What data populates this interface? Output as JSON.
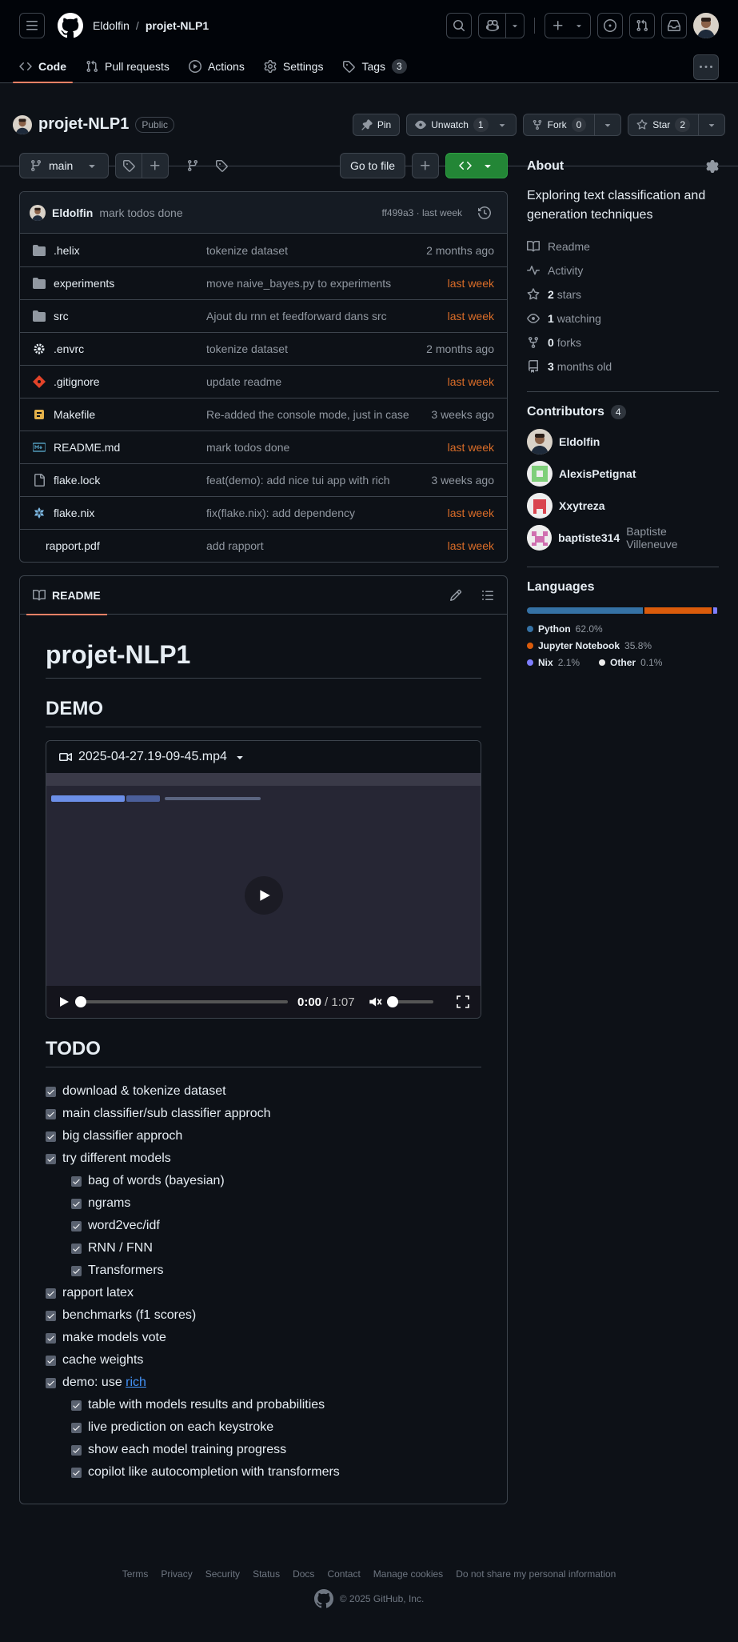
{
  "header": {
    "owner": "Eldolfin",
    "separator": "/",
    "repo": "projet-NLP1"
  },
  "nav": {
    "tabs": [
      {
        "label": "Code",
        "icon": "code-icon"
      },
      {
        "label": "Pull requests",
        "icon": "git-pull-request-icon"
      },
      {
        "label": "Actions",
        "icon": "play-icon"
      },
      {
        "label": "Settings",
        "icon": "gear-icon"
      },
      {
        "label": "Tags",
        "icon": "tag-icon",
        "count": "3"
      }
    ]
  },
  "repo": {
    "name": "projet-NLP1",
    "visibility": "Public",
    "pin_label": "Pin",
    "watch_label": "Unwatch",
    "watch_count": "1",
    "fork_label": "Fork",
    "fork_count": "0",
    "star_label": "Star",
    "star_count": "2"
  },
  "toolbar": {
    "branch": "main",
    "go_to_file": "Go to file"
  },
  "commit": {
    "author": "Eldolfin",
    "message": "mark todos done",
    "meta": "ff499a3 · last week"
  },
  "files": [
    {
      "name": ".helix",
      "type": "folder",
      "message": "tokenize dataset",
      "date": "2 months ago",
      "recent": false
    },
    {
      "name": "experiments",
      "type": "folder",
      "message": "move naive_bayes.py to experiments",
      "date": "last week",
      "recent": true
    },
    {
      "name": "src",
      "type": "folder",
      "message": "Ajout du rnn et feedforward dans src",
      "date": "last week",
      "recent": true
    },
    {
      "name": ".envrc",
      "type": "gear",
      "message": "tokenize dataset",
      "date": "2 months ago",
      "recent": false
    },
    {
      "name": ".gitignore",
      "type": "git",
      "message": "update readme",
      "date": "last week",
      "recent": true
    },
    {
      "name": "Makefile",
      "type": "make",
      "message": "Re-added the console mode, just in case",
      "date": "3 weeks ago",
      "recent": false
    },
    {
      "name": "README.md",
      "type": "markdown",
      "message": "mark todos done",
      "date": "last week",
      "recent": true
    },
    {
      "name": "flake.lock",
      "type": "file",
      "message": "feat(demo): add nice tui app with rich",
      "date": "3 weeks ago",
      "recent": false
    },
    {
      "name": "flake.nix",
      "type": "nix",
      "message": "fix(flake.nix): add dependency",
      "date": "last week",
      "recent": true
    },
    {
      "name": "rapport.pdf",
      "type": "none",
      "message": "add rapport",
      "date": "last week",
      "recent": true
    }
  ],
  "readme": {
    "tab_label": "README",
    "title": "projet-NLP1",
    "demo_heading": "DEMO",
    "video_file": "2025-04-27.19-09-45.mp4",
    "video_time": "0:00",
    "video_duration": "/ 1:07",
    "todo_heading": "TODO",
    "todos": [
      {
        "text": "download & tokenize dataset",
        "sub": false
      },
      {
        "text": "main classifier/sub classifier approch",
        "sub": false
      },
      {
        "text": "big classifier approch",
        "sub": false
      },
      {
        "text": "try different models",
        "sub": false
      },
      {
        "text": "bag of words (bayesian)",
        "sub": true
      },
      {
        "text": "ngrams",
        "sub": true
      },
      {
        "text": "word2vec/idf",
        "sub": true
      },
      {
        "text": "RNN / FNN",
        "sub": true
      },
      {
        "text": "Transformers",
        "sub": true
      },
      {
        "text": "rapport latex",
        "sub": false
      },
      {
        "text": "benchmarks (f1 scores)",
        "sub": false
      },
      {
        "text": "make models vote",
        "sub": false
      },
      {
        "text": "cache weights",
        "sub": false
      },
      {
        "text": "demo: use ",
        "link": "rich",
        "sub": false
      },
      {
        "text": "table with models results and probabilities",
        "sub": true
      },
      {
        "text": "live prediction on each keystroke",
        "sub": true
      },
      {
        "text": "show each model training progress",
        "sub": true
      },
      {
        "text": "copilot like autocompletion with transformers",
        "sub": true
      }
    ]
  },
  "about": {
    "heading": "About",
    "description": "Exploring text classification and generation techniques",
    "readme": "Readme",
    "activity": "Activity",
    "stars_count": "2",
    "stars_label": "stars",
    "watching_count": "1",
    "watching_label": "watching",
    "forks_count": "0",
    "forks_label": "forks",
    "age_count": "3",
    "age_label": "months old"
  },
  "contributors": {
    "heading": "Contributors",
    "count": "4",
    "list": [
      {
        "login": "Eldolfin",
        "name": ""
      },
      {
        "login": "AlexisPetignat",
        "name": ""
      },
      {
        "login": "Xxytreza",
        "name": ""
      },
      {
        "login": "baptiste314",
        "name": "Baptiste Villeneuve"
      }
    ]
  },
  "languages": {
    "heading": "Languages",
    "list": [
      {
        "name": "Python",
        "percent": "62.0%",
        "value": 62.0,
        "color": "#3572A5"
      },
      {
        "name": "Jupyter Notebook",
        "percent": "35.8%",
        "value": 35.8,
        "color": "#DA5B0B"
      },
      {
        "name": "Nix",
        "percent": "2.1%",
        "value": 2.1,
        "color": "#7e7eff"
      },
      {
        "name": "Other",
        "percent": "0.1%",
        "value": 0.1,
        "color": "#ededed"
      }
    ]
  },
  "footer": {
    "links": [
      "Terms",
      "Privacy",
      "Security",
      "Status",
      "Docs",
      "Contact",
      "Manage cookies",
      "Do not share my personal information"
    ],
    "copyright": "© 2025 GitHub, Inc."
  }
}
